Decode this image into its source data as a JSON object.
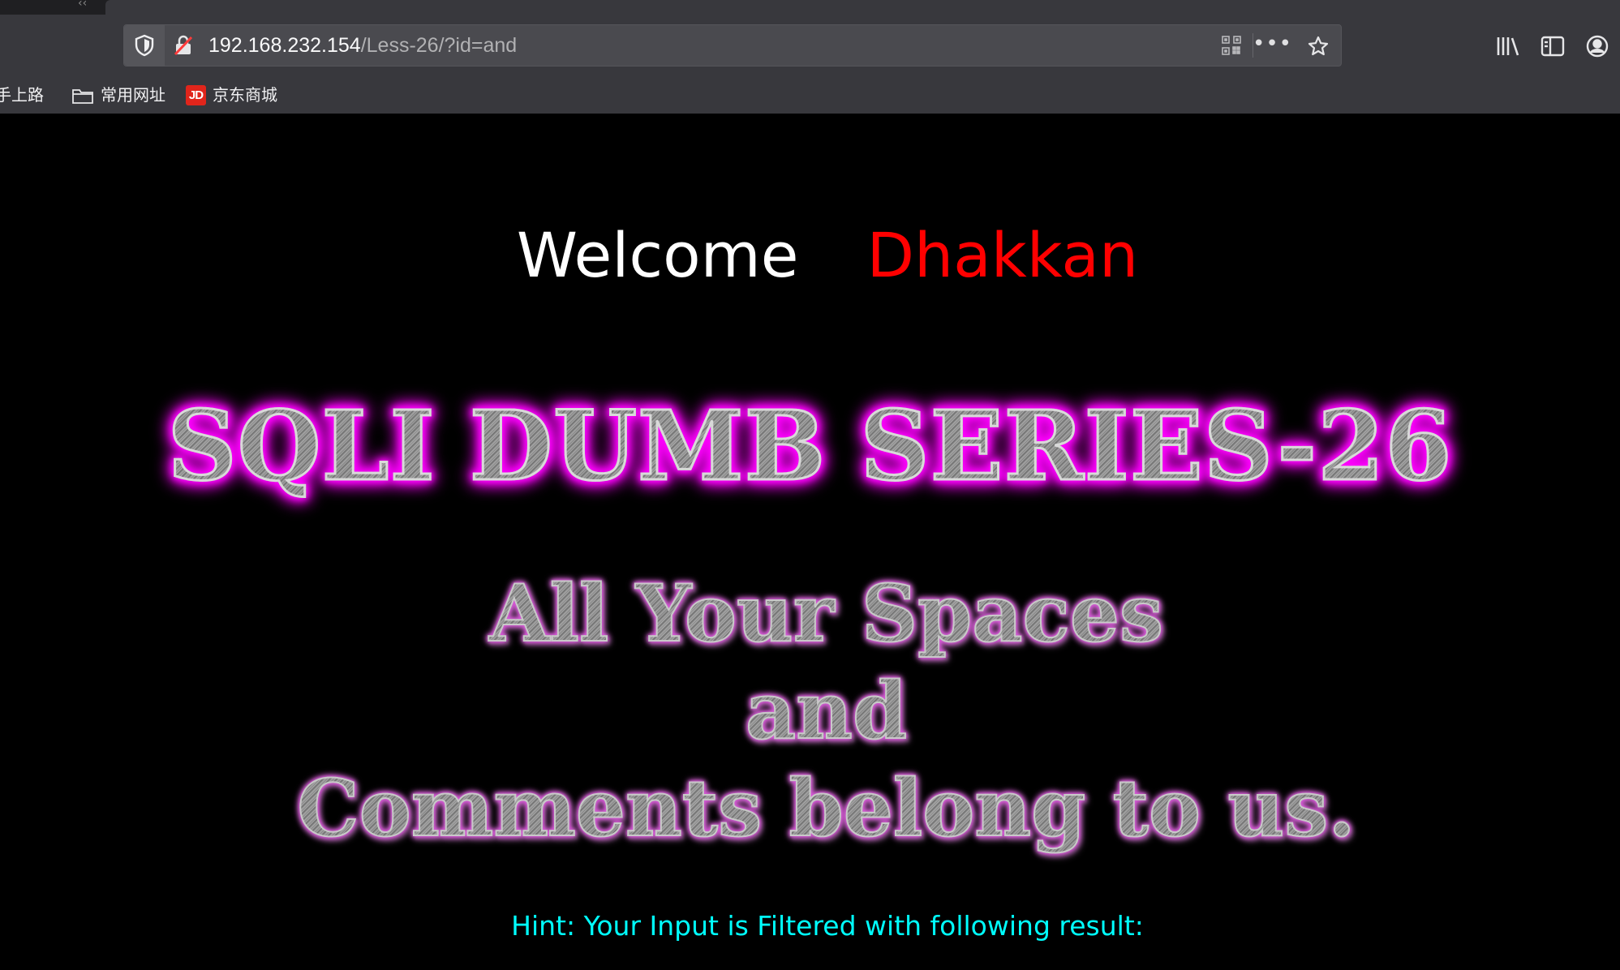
{
  "browser": {
    "url": {
      "host": "192.168.232.154",
      "path": "/Less-26/?id=and"
    },
    "bookmarks": [
      {
        "label": "手上路",
        "icon": "firefox-icon"
      },
      {
        "label": "常用网址",
        "icon": "folder-icon"
      },
      {
        "label": "京东商城",
        "icon": "jd-icon",
        "badge": "JD"
      }
    ],
    "toolbar_icons": [
      "shield-icon",
      "insecure-lock-icon",
      "qr-code-icon",
      "more-icon",
      "bookmark-star-icon",
      "library-icon",
      "sidebar-icon",
      "account-icon"
    ]
  },
  "page": {
    "welcome": "Welcome",
    "name": "Dhakkan",
    "banner": "SQLI DUMB SERIES-26",
    "slogan": [
      "All Your Spaces",
      "and",
      "Comments belong to us."
    ],
    "hint": "Hint: Your Input is Filtered with following result:"
  },
  "colors": {
    "background": "#000000",
    "welcome": "#ffffff",
    "name": "#ff0000",
    "banner_glow": "#ff00ff",
    "hint": "#00ffff",
    "chrome": "#38383d"
  }
}
